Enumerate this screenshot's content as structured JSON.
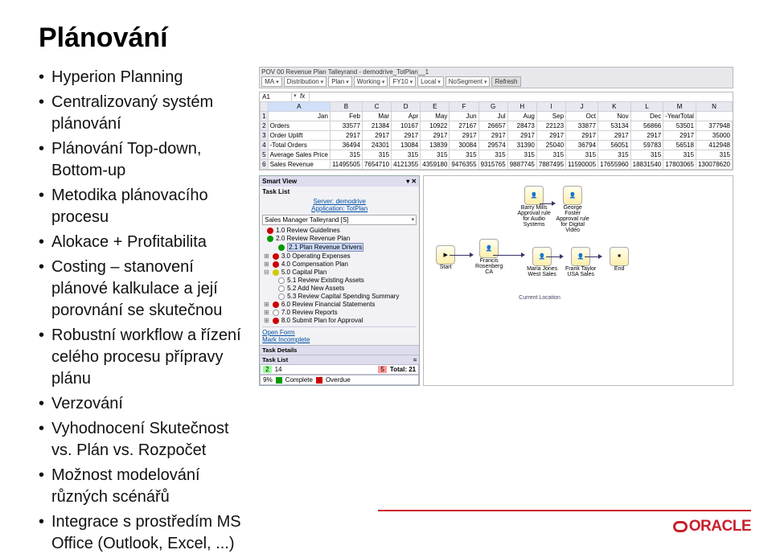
{
  "title": "Plánování",
  "bullets": [
    "Hyperion Planning",
    "Centralizovaný systém plánování",
    "Plánování Top-down, Bottom-up",
    "Metodika plánovacího procesu",
    "Alokace + Profitabilita",
    "Costing – stanovení plánové kalkulace a její porovnání se skutečnou",
    "Robustní workflow a řízení celého procesu přípravy plánu",
    "Verzování",
    "Vyhodnocení Skutečnost vs. Plán vs. Rozpočet",
    "Možnost modelování různých scénářů",
    "Integrace s prostředím MS Office (Outlook, Excel, ...)"
  ],
  "pov_title": "POV 00 Revenue Plan Talleyrand - demodrive_TotPlan__1",
  "pov_selectors": [
    "MA",
    "Distribution",
    "Plan",
    "Working",
    "FY10",
    "Local",
    "NoSegment"
  ],
  "pov_refresh": "Refresh",
  "namebox": "A1",
  "grid_cols": [
    "",
    "A",
    "B",
    "C",
    "D",
    "E",
    "F",
    "G",
    "H",
    "I",
    "J",
    "K",
    "L",
    "M",
    "N"
  ],
  "months": [
    "",
    "Jan",
    "Feb",
    "Mar",
    "Apr",
    "May",
    "Jun",
    "Jul",
    "Aug",
    "Sep",
    "Oct",
    "Nov",
    "Dec",
    "-YearTotal"
  ],
  "grid_rows": [
    {
      "n": "2",
      "label": "Orders",
      "v": [
        "33577",
        "21384",
        "10167",
        "10922",
        "27167",
        "26657",
        "28473",
        "22123",
        "33877",
        "53134",
        "56866",
        "53501",
        "377948"
      ]
    },
    {
      "n": "3",
      "label": "Order Uplift",
      "v": [
        "2917",
        "2917",
        "2917",
        "2917",
        "2917",
        "2917",
        "2917",
        "2917",
        "2917",
        "2917",
        "2917",
        "2917",
        "35000"
      ]
    },
    {
      "n": "4",
      "label": "-Total Orders",
      "v": [
        "36494",
        "24301",
        "13084",
        "13839",
        "30084",
        "29574",
        "31390",
        "25040",
        "36794",
        "56051",
        "59783",
        "56518",
        "412948"
      ]
    },
    {
      "n": "5",
      "label": "Average Sales Price",
      "v": [
        "315",
        "315",
        "315",
        "315",
        "315",
        "315",
        "315",
        "315",
        "315",
        "315",
        "315",
        "315",
        "315"
      ]
    },
    {
      "n": "6",
      "label": "Sales Revenue",
      "v": [
        "11495505",
        "7654710",
        "4121355",
        "4359180",
        "9476355",
        "9315765",
        "9887745",
        "7887495",
        "11590005",
        "17655960",
        "18831540",
        "17803065",
        "130078620"
      ]
    }
  ],
  "smartview": {
    "pane_title": "Smart View",
    "task_list": "Task List",
    "server": "Server: demodrive",
    "app": "Application: TotPlan",
    "role": "Sales Manager Talleyrand [S]",
    "tree": [
      {
        "t": "1.0 Review Guidelines",
        "c": "red",
        "ind": 0
      },
      {
        "t": "2.0 Review Revenue Plan",
        "c": "green",
        "ind": 0
      },
      {
        "t": "2.1 Plan Revenue Drivers",
        "c": "green",
        "ind": 1,
        "sel": true
      },
      {
        "t": "3.0 Operating Expenses",
        "c": "red",
        "ind": 0,
        "exp": true
      },
      {
        "t": "4.0 Compensation Plan",
        "c": "red",
        "ind": 0,
        "exp": true
      },
      {
        "t": "5.0 Capital Plan",
        "c": "yellow",
        "ind": 0,
        "exp": false
      },
      {
        "t": "5.1 Review Existing Assets",
        "c": "white",
        "ind": 1
      },
      {
        "t": "5.2 Add New Assets",
        "c": "white",
        "ind": 1
      },
      {
        "t": "5.3 Review Capital Spending Summary",
        "c": "white",
        "ind": 1
      },
      {
        "t": "6.0 Review Financial Statements",
        "c": "red",
        "ind": 0,
        "exp": true
      },
      {
        "t": "7.0 Review Reports",
        "c": "white",
        "ind": 0,
        "exp": true
      },
      {
        "t": "8.0 Submit Plan for Approval",
        "c": "red",
        "ind": 0,
        "exp": true
      }
    ],
    "open_form": "Open Form",
    "mark_incomplete": "Mark Incomplete",
    "task_details": "Task Details",
    "task_list_footer": "Task List",
    "count_a": "2",
    "count_b": "14",
    "count_c": "5",
    "total": "Total: 21",
    "complete": "9%",
    "complete_label": "Complete",
    "overdue": "Overdue"
  },
  "workflow": {
    "start": "Start",
    "end": "End",
    "francis": "Francis Rosenberg CA",
    "barry": "Barry Mills Approval rule for Audio Systems",
    "george": "George Foster Approval rule for Digital Video",
    "maria": "Maria Jones West Sales",
    "frank": "Frank Taylor USA Sales",
    "current": "Current Location"
  },
  "oracle": "ORACLE"
}
